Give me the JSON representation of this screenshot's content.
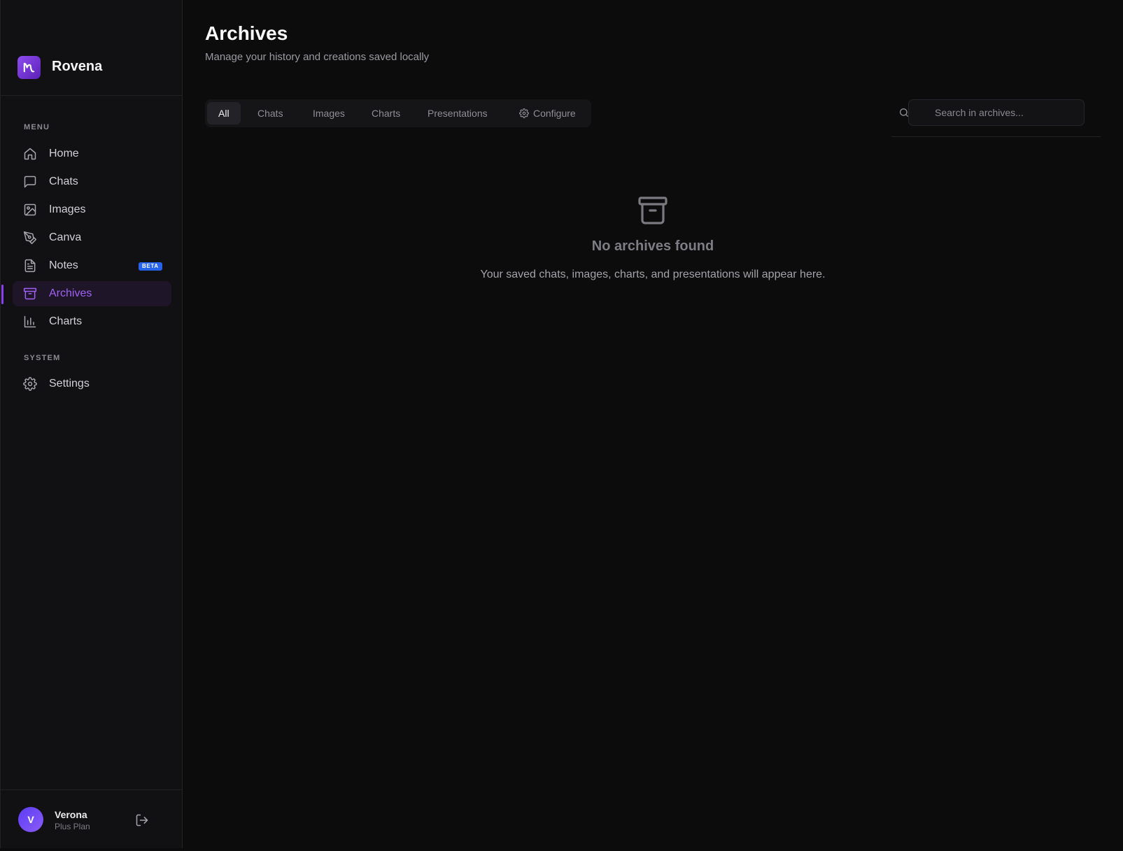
{
  "brand": {
    "name": "Rovena"
  },
  "sidebar": {
    "menu_label": "MENU",
    "items": [
      {
        "label": "Home",
        "icon": "home-icon"
      },
      {
        "label": "Chats",
        "icon": "message-square-icon"
      },
      {
        "label": "Images",
        "icon": "image-icon"
      },
      {
        "label": "Canva",
        "icon": "pen-tool-icon"
      },
      {
        "label": "Notes",
        "icon": "file-text-icon",
        "badge": "BETA"
      },
      {
        "label": "Archives",
        "icon": "archive-icon",
        "active": true
      },
      {
        "label": "Charts",
        "icon": "bar-chart-icon"
      }
    ],
    "system_label": "SYSTEM",
    "system_items": [
      {
        "label": "Settings",
        "icon": "gear-icon"
      }
    ]
  },
  "user": {
    "initial": "V",
    "name": "Verona",
    "plan": "Plus Plan"
  },
  "header": {
    "title": "Archives",
    "subtitle": "Manage your history and creations saved locally"
  },
  "tabs": [
    {
      "label": "All",
      "active": true
    },
    {
      "label": "Chats"
    },
    {
      "label": "Images"
    },
    {
      "label": "Charts"
    },
    {
      "label": "Presentations"
    },
    {
      "label": "Configure",
      "icon": "gear-icon"
    }
  ],
  "search": {
    "placeholder": "Search in archives...",
    "value": ""
  },
  "empty_state": {
    "icon": "archive-icon",
    "title": "No archives found",
    "description": "Your saved chats, images, charts, and presentations will appear here."
  },
  "colors": {
    "accent": "#a160f5",
    "background": "#0c0c0d",
    "sidebar": "#111113",
    "beta_badge": "#2563eb"
  }
}
